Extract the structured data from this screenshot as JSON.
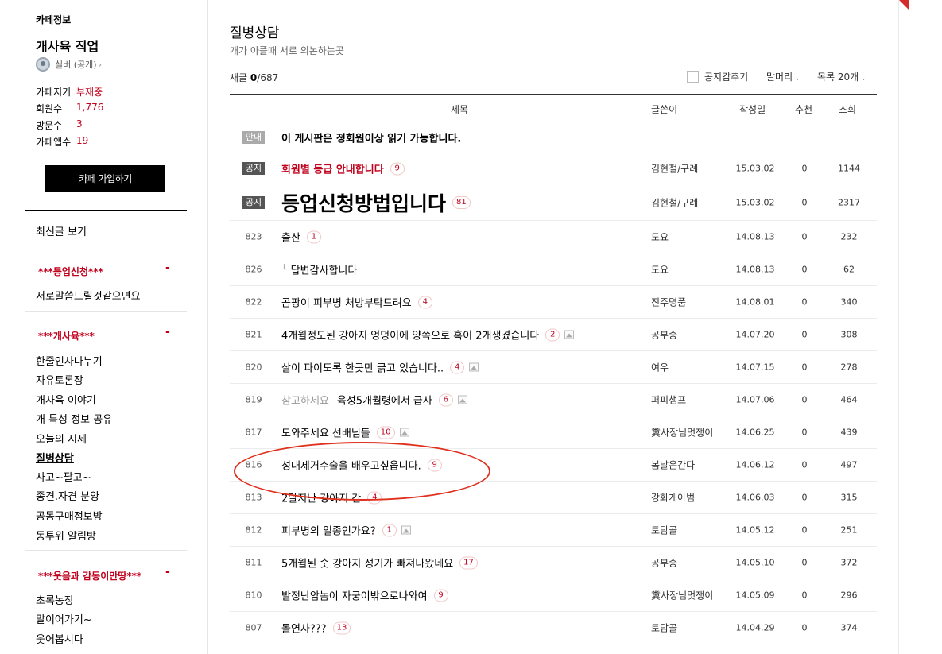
{
  "sidebar": {
    "cafe_info_label": "카페정보",
    "cafe_name": "개사육 직업",
    "grade": "실버 (공개)",
    "stats": [
      {
        "label": "카페지기",
        "value": "부재중"
      },
      {
        "label": "회원수",
        "value": "1,776"
      },
      {
        "label": "방문수",
        "value": "3"
      },
      {
        "label": "카페앱수",
        "value": "19"
      }
    ],
    "join_button": "카페 가입하기",
    "recent_link": "최신글 보기",
    "toggle_symbol": "-",
    "groups": [
      {
        "title": "***등업신청***",
        "items": [
          "저로말씀드릴것같으면요"
        ]
      },
      {
        "title": "***개사육***",
        "items": [
          "한줄인사나누기",
          "자유토론장",
          "개사육 이야기",
          "개 특성 정보 공유",
          "오늘의 시세",
          "질병상담",
          "사고~팔고~",
          "종견.자견 분양",
          "공동구매정보방",
          "동투위 알림방"
        ]
      },
      {
        "title": "***웃음과 감동이만땅***",
        "items": [
          "초록농장",
          "말이어가기~",
          "웃어봅시다"
        ]
      }
    ],
    "active_item": "질병상담"
  },
  "board": {
    "title": "질병상담",
    "description": "개가 아플때 서로 의논하는곳",
    "new_label": "새글",
    "new_count": "0",
    "total_count": "/687",
    "hide_notice_label": "공지감추기",
    "header_select": "말머리",
    "list_size_select": "목록 20개",
    "columns": {
      "title": "제목",
      "author": "글쓴이",
      "date": "작성일",
      "likes": "추천",
      "views": "조회"
    }
  },
  "posts": [
    {
      "badge": "안내",
      "type": "guide",
      "title": "이 게시판은 정회원이상 읽기 가능합니다."
    },
    {
      "badge": "공지",
      "type": "notice",
      "title": "회원별 등급 안내합니다",
      "comments": "9",
      "author": "김현철/구례",
      "date": "15.03.02",
      "likes": "0",
      "views": "1144",
      "style": "red"
    },
    {
      "badge": "공지",
      "type": "notice",
      "title": "등업신청방법입니다",
      "comments": "81",
      "author": "김현철/구례",
      "date": "15.03.02",
      "likes": "0",
      "views": "2317",
      "style": "big"
    },
    {
      "num": "823",
      "title": "출산",
      "comments": "1",
      "author": "도요",
      "date": "14.08.13",
      "likes": "0",
      "views": "232"
    },
    {
      "num": "826",
      "title": "답변감사합니다",
      "reply": true,
      "author": "도요",
      "date": "14.08.13",
      "likes": "0",
      "views": "62"
    },
    {
      "num": "822",
      "title": "곰팡이 피부병 처방부탁드려요",
      "comments": "4",
      "author": "진주명품",
      "date": "14.08.01",
      "likes": "0",
      "views": "340"
    },
    {
      "num": "821",
      "title": "4개월정도된 강아지 엉덩이에 양쪽으로 혹이 2개생겼습니다",
      "comments": "2",
      "image": true,
      "author": "공부중",
      "date": "14.07.20",
      "likes": "0",
      "views": "308"
    },
    {
      "num": "820",
      "title": "살이 파이도록 한곳만 긁고 있습니다..",
      "comments": "4",
      "image": true,
      "author": "여우",
      "date": "14.07.15",
      "likes": "0",
      "views": "278"
    },
    {
      "num": "819",
      "head": "참고하세요",
      "title": "육성5개월령에서 급사",
      "comments": "6",
      "image": true,
      "author": "퍼피챔프",
      "date": "14.07.06",
      "likes": "0",
      "views": "464"
    },
    {
      "num": "817",
      "title": "도와주세요 선배님들",
      "comments": "10",
      "image": true,
      "author": "糞사장님멋쟁이",
      "date": "14.06.25",
      "likes": "0",
      "views": "439"
    },
    {
      "num": "816",
      "title": "성대제거수술을 배우고싶읍니다.",
      "comments": "9",
      "author": "봄날은간다",
      "date": "14.06.12",
      "likes": "0",
      "views": "497"
    },
    {
      "num": "813",
      "title": "2달지난 강아지 간",
      "comments": "4",
      "author": "강화개아범",
      "date": "14.06.03",
      "likes": "0",
      "views": "315"
    },
    {
      "num": "812",
      "title": "피부병의 일종인가요?",
      "comments": "1",
      "image": true,
      "author": "토담골",
      "date": "14.05.12",
      "likes": "0",
      "views": "251"
    },
    {
      "num": "811",
      "title": "5개월된 숫 강아지 성기가 빠져나왔네요",
      "comments": "17",
      "author": "공부중",
      "date": "14.05.10",
      "likes": "0",
      "views": "372"
    },
    {
      "num": "810",
      "title": "발정난암놈이 자궁이밖으로나와여",
      "comments": "9",
      "author": "糞사장님멋쟁이",
      "date": "14.05.09",
      "likes": "0",
      "views": "296"
    },
    {
      "num": "807",
      "title": "돌연사???",
      "comments": "13",
      "author": "토담골",
      "date": "14.04.29",
      "likes": "0",
      "views": "374"
    }
  ],
  "colors": {
    "accent": "#c1001c",
    "highlight": "#e0301e"
  }
}
